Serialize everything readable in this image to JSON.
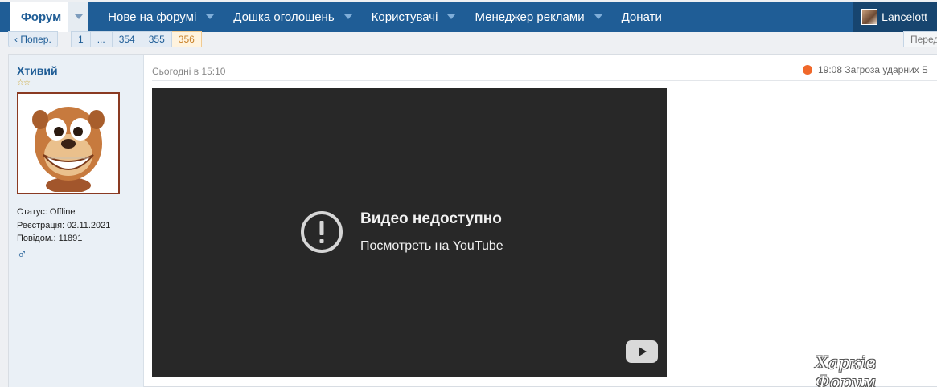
{
  "navbar": {
    "home_label": "Форум",
    "items": [
      {
        "label": "Нове на форумі",
        "has_dropdown": true
      },
      {
        "label": "Дошка оголошень",
        "has_dropdown": true
      },
      {
        "label": "Користувачі",
        "has_dropdown": true
      },
      {
        "label": "Менеджер реклами",
        "has_dropdown": true
      },
      {
        "label": "Донати",
        "has_dropdown": false
      }
    ],
    "user_name": "Lancelott"
  },
  "pagination": {
    "prev_label": "‹ Попер.",
    "pages": [
      "1",
      "...",
      "354",
      "355",
      "356"
    ],
    "current_page": "356",
    "next_label": "Перед"
  },
  "post": {
    "author": {
      "name": "Хтивий",
      "stars": "☆☆",
      "status": "Статус: Offline",
      "registered": "Реєстрація: 02.11.2021",
      "posts": "Повідом.: 11891",
      "gender_icon": "♂"
    },
    "date": "Сьогодні в 15:10",
    "recent_topic": "19:08 Загроза ударних Б",
    "video": {
      "title": "Видео недоступно",
      "link_text": "Посмотреть на YouTube"
    }
  },
  "watermark": "Харків Форум",
  "colors": {
    "nav_bg": "#1f5d96",
    "nav_user_bg": "#17456f",
    "accent_orange": "#f0682a",
    "video_bg": "#282828",
    "sidebar_bg": "#eaf0f6"
  },
  "icons": [
    "dropdown-caret-icon",
    "alert-circle-icon",
    "youtube-logo-icon",
    "male-gender-icon",
    "star-rank-icon",
    "status-dot-icon"
  ]
}
